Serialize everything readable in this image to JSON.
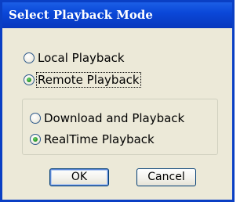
{
  "dialog": {
    "title": "Select Playback Mode"
  },
  "mode": {
    "options": [
      {
        "label": "Local Playback",
        "checked": false
      },
      {
        "label": "Remote Playback",
        "checked": true
      }
    ]
  },
  "remote_type": {
    "options": [
      {
        "label": "Download and Playback",
        "checked": false
      },
      {
        "label": "RealTime Playback",
        "checked": true
      }
    ]
  },
  "buttons": {
    "ok_label": "OK",
    "cancel_label": "Cancel"
  },
  "colors": {
    "title_bar": "#0a47d8",
    "dialog_background": "#ece9d8",
    "radio_selected": "#2a9a2a"
  }
}
